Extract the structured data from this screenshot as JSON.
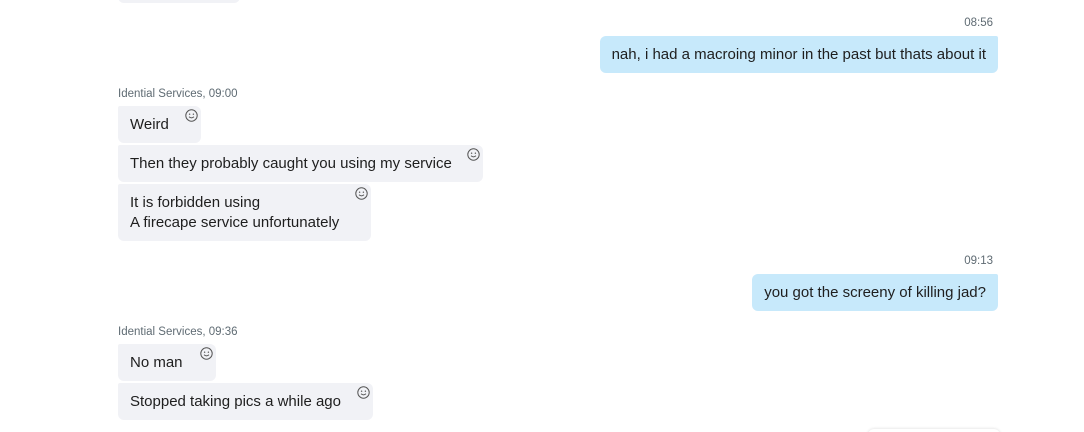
{
  "conversation": {
    "outgoing_1": {
      "time": "08:56",
      "text": "nah, i had a macroing minor in the past but thats about it"
    },
    "incoming_group_1": {
      "sender_time": "Idential Services, 09:00",
      "messages": [
        "Weird",
        "Then they probably caught you using my service"
      ],
      "multiline": {
        "line1": "It is forbidden using",
        "line2": "A firecape service unfortunately"
      }
    },
    "outgoing_2": {
      "time": "09:13",
      "text": "you got the screeny of killing jad?"
    },
    "incoming_group_2": {
      "sender_time": "Idential Services, 09:36",
      "messages": [
        "No man",
        "Stopped taking pics a while ago"
      ]
    }
  },
  "icons": {
    "reaction": "smiley-reaction-icon"
  },
  "colors": {
    "incoming_bubble": "#f1f2f6",
    "outgoing_bubble": "#c7e9fb",
    "meta_text": "#5f6b73"
  }
}
